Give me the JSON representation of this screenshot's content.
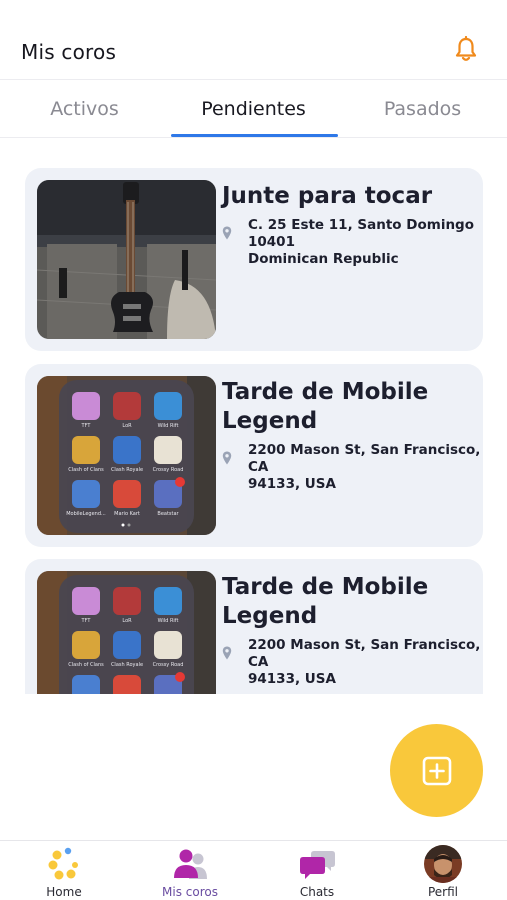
{
  "header": {
    "title": "Mis coros",
    "notification_icon": "bell-icon",
    "accent": "#f08a1c"
  },
  "tabs": [
    {
      "label": "Activos",
      "active": false
    },
    {
      "label": "Pendientes",
      "active": true
    },
    {
      "label": "Pasados",
      "active": false
    }
  ],
  "coros": [
    {
      "name": "Junte para tocar",
      "address": "C. 25 Este 11, Santo Domingo 10401\nDominican Republic",
      "image": "guitar-photo"
    },
    {
      "name": "Tarde de Mobile Legend",
      "address": "2200 Mason St, San Francisco, CA\n94133, USA",
      "image": "mobile-games-folder-screenshot"
    },
    {
      "name": "Tarde de Mobile Legend",
      "address": "2200 Mason St, San Francisco, CA\n94133, USA",
      "image": "mobile-games-folder-screenshot"
    }
  ],
  "thumb_apps": [
    {
      "label": "TFT"
    },
    {
      "label": "LoR"
    },
    {
      "label": "Wild Rift"
    },
    {
      "label": "Clash of Clans"
    },
    {
      "label": "Clash Royale"
    },
    {
      "label": "Crossy Road"
    },
    {
      "label": "MobileLegend..."
    },
    {
      "label": "Mario Kart"
    },
    {
      "label": "Beatstar",
      "badge": "1"
    }
  ],
  "fab": {
    "icon": "add-square-icon",
    "color": "#f9c83b"
  },
  "bottom_nav": [
    {
      "label": "Home",
      "icon": "home-logo-icon",
      "active": false
    },
    {
      "label": "Mis coros",
      "icon": "users-icon",
      "active": true
    },
    {
      "label": "Chats",
      "icon": "chat-bubbles-icon",
      "active": false
    },
    {
      "label": "Perfil",
      "icon": "avatar-icon",
      "active": false
    }
  ],
  "colors": {
    "tab_indicator": "#2e78e8",
    "card_bg": "#eef1f7",
    "active_nav": "#6a4da1"
  }
}
